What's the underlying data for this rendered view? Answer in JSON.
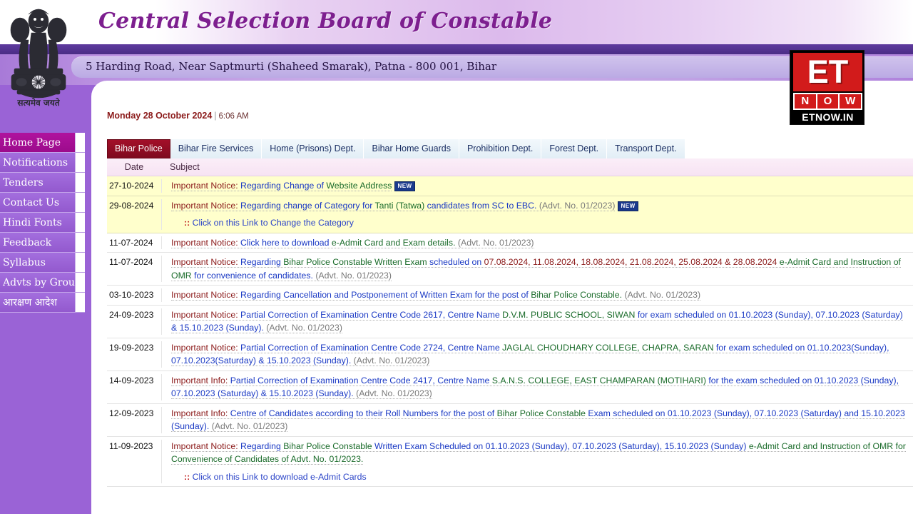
{
  "header": {
    "title": "Central Selection Board of Constable",
    "address": "5 Harding Road, Near Saptmurti (Shaheed Smarak), Patna - 800 001, Bihar",
    "emblem_caption": "सत्यमेव जयते"
  },
  "watermark": {
    "et": "ET",
    "now": [
      "N",
      "O",
      "W"
    ],
    "domain": "ETNOW.IN"
  },
  "sidebar": {
    "items": [
      {
        "label": "Home Page",
        "active": true
      },
      {
        "label": "Notifications",
        "active": false
      },
      {
        "label": "Tenders",
        "active": false
      },
      {
        "label": "Contact Us",
        "active": false
      },
      {
        "label": "Hindi Fonts",
        "active": false
      },
      {
        "label": "Feedback",
        "active": false
      },
      {
        "label": "Syllabus",
        "active": false
      },
      {
        "label": "Advts by Group",
        "active": false
      },
      {
        "label": "आरक्षण आदेश",
        "active": false
      }
    ]
  },
  "datebar": {
    "date": "Monday 28 October 2024",
    "separator": "|",
    "time": "6:06 AM"
  },
  "tabs": [
    {
      "label": "Bihar Police",
      "active": true
    },
    {
      "label": "Bihar Fire Services",
      "active": false
    },
    {
      "label": "Home (Prisons) Dept.",
      "active": false
    },
    {
      "label": "Bihar Home Guards",
      "active": false
    },
    {
      "label": "Prohibition Dept.",
      "active": false
    },
    {
      "label": "Forest Dept.",
      "active": false
    },
    {
      "label": "Transport Dept.",
      "active": false
    }
  ],
  "table": {
    "columns": {
      "date": "Date",
      "subject": "Subject"
    },
    "rows": [
      {
        "date": "27-10-2024",
        "highlight": true,
        "parts": [
          {
            "text": "Important Notice:",
            "color": "red"
          },
          {
            "text": " Regarding Change of",
            "color": "blue"
          },
          {
            "text": " Website Address",
            "color": "green"
          }
        ],
        "badge": "NEW",
        "sublink": null
      },
      {
        "date": "29-08-2024",
        "highlight": true,
        "parts": [
          {
            "text": "Important Notice:",
            "color": "red"
          },
          {
            "text": " Regarding change of Category for",
            "color": "blue"
          },
          {
            "text": " Tanti (Tatwa)",
            "color": "green"
          },
          {
            "text": " candidates from SC to EBC.",
            "color": "blue"
          },
          {
            "text": " (Advt. No. 01/2023)",
            "color": "gray"
          }
        ],
        "badge": "NEW",
        "sublink": ":: Click on this Link to Change the Category"
      },
      {
        "date": "11-07-2024",
        "highlight": false,
        "parts": [
          {
            "text": "Important Notice:",
            "color": "red"
          },
          {
            "text": " Click here to download",
            "color": "blue"
          },
          {
            "text": " e-Admit Card and Exam details.",
            "color": "green"
          },
          {
            "text": " (Advt. No. 01/2023)",
            "color": "gray"
          }
        ],
        "badge": null,
        "sublink": null
      },
      {
        "date": "11-07-2024",
        "highlight": false,
        "parts": [
          {
            "text": "Important Notice:",
            "color": "red"
          },
          {
            "text": " Regarding",
            "color": "blue"
          },
          {
            "text": " Bihar Police Constable Written Exam",
            "color": "green"
          },
          {
            "text": " scheduled on",
            "color": "blue"
          },
          {
            "text": " 07.08.2024, 11.08.2024, 18.08.2024, 21.08.2024, 25.08.2024 & 28.08.2024",
            "color": "red"
          },
          {
            "text": " e-Admit Card and Instruction of OMR",
            "color": "green"
          },
          {
            "text": " for convenience of candidates.",
            "color": "blue"
          },
          {
            "text": " (Advt. No. 01/2023)",
            "color": "gray"
          }
        ],
        "badge": null,
        "sublink": null
      },
      {
        "date": "03-10-2023",
        "highlight": false,
        "parts": [
          {
            "text": "Important Notice:",
            "color": "red"
          },
          {
            "text": " Regarding Cancellation and Postponement of Written Exam for the post of",
            "color": "blue"
          },
          {
            "text": " Bihar Police Constable.",
            "color": "green"
          },
          {
            "text": " (Advt. No. 01/2023)",
            "color": "gray"
          }
        ],
        "badge": null,
        "sublink": null
      },
      {
        "date": "24-09-2023",
        "highlight": false,
        "parts": [
          {
            "text": "Important Notice:",
            "color": "red"
          },
          {
            "text": " Partial Correction of Examination Centre Code 2617, Centre Name",
            "color": "blue"
          },
          {
            "text": " D.V.M. PUBLIC SCHOOL, SIWAN",
            "color": "green"
          },
          {
            "text": " for exam scheduled on 01.10.2023 (Sunday), 07.10.2023 (Saturday) & 15.10.2023 (Sunday).",
            "color": "blue"
          },
          {
            "text": " (Advt. No. 01/2023)",
            "color": "gray"
          }
        ],
        "badge": null,
        "sublink": null
      },
      {
        "date": "19-09-2023",
        "highlight": false,
        "parts": [
          {
            "text": "Important Notice:",
            "color": "red"
          },
          {
            "text": " Partial Correction of Examination Centre Code 2724, Centre Name",
            "color": "blue"
          },
          {
            "text": " JAGLAL CHOUDHARY COLLEGE, CHAPRA, SARAN",
            "color": "green"
          },
          {
            "text": " for exam scheduled on 01.10.2023(Sunday), 07.10.2023(Saturday) & 15.10.2023 (Sunday).",
            "color": "blue"
          },
          {
            "text": " (Advt. No. 01/2023)",
            "color": "gray"
          }
        ],
        "badge": null,
        "sublink": null
      },
      {
        "date": "14-09-2023",
        "highlight": false,
        "parts": [
          {
            "text": "Important Info:",
            "color": "red"
          },
          {
            "text": " Partial Correction of Examination Centre Code 2417, Centre Name",
            "color": "blue"
          },
          {
            "text": " S.A.N.S. COLLEGE, EAST CHAMPARAN (MOTIHARI)",
            "color": "green"
          },
          {
            "text": " for the exam scheduled on 01.10.2023 (Sunday), 07.10.2023 (Saturday) & 15.10.2023 (Sunday).",
            "color": "blue"
          },
          {
            "text": " (Advt. No. 01/2023)",
            "color": "gray"
          }
        ],
        "badge": null,
        "sublink": null
      },
      {
        "date": "12-09-2023",
        "highlight": false,
        "parts": [
          {
            "text": "Important Info:",
            "color": "red"
          },
          {
            "text": " Centre of Candidates according to their Roll Numbers for the post of",
            "color": "blue"
          },
          {
            "text": " Bihar Police Constable",
            "color": "green"
          },
          {
            "text": " Exam scheduled on 01.10.2023 (Sunday), 07.10.2023 (Saturday) and 15.10.2023 (Sunday).",
            "color": "blue"
          },
          {
            "text": " (Advt. No. 01/2023)",
            "color": "gray"
          }
        ],
        "badge": null,
        "sublink": null
      },
      {
        "date": "11-09-2023",
        "highlight": false,
        "parts": [
          {
            "text": "Important Notice:",
            "color": "red"
          },
          {
            "text": " Regarding",
            "color": "blue"
          },
          {
            "text": " Bihar Police Constable",
            "color": "green"
          },
          {
            "text": " Written Exam Scheduled on 01.10.2023 (Sunday), 07.10.2023 (Saturday), 15.10.2023 (Sunday)",
            "color": "blue"
          },
          {
            "text": " e-Admit Card and Instruction of OMR for Convenience of Candidates of Advt. No. 01/2023.",
            "color": "green"
          }
        ],
        "badge": null,
        "sublink": ":: Click on this Link to download e-Admit Cards"
      }
    ]
  }
}
